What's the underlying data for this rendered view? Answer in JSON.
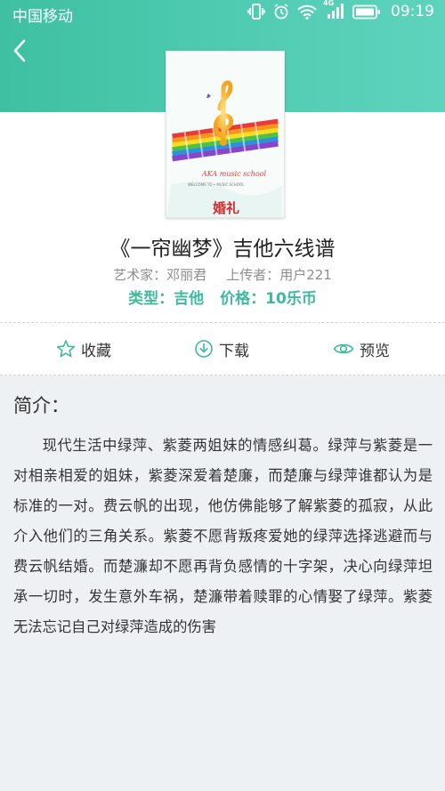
{
  "status_bar": {
    "carrier": "中国移动",
    "network_label": "4G",
    "time": "09:19"
  },
  "header": {
    "back_icon": "chevron-left-icon",
    "background_color": "#4fcab0"
  },
  "cover": {
    "headline": "AKA music school",
    "subline": "WELCOME TO • MUSIC SCHOOL",
    "logo_text": "婚礼"
  },
  "score": {
    "title": "《一帘幽梦》吉他六线谱",
    "artist_label": "艺术家：邓丽君",
    "uploader_label": "上传者：用户221",
    "type_label": "类型：吉他",
    "price_label": "价格：10乐币"
  },
  "actions": [
    {
      "label": "收藏",
      "icon": "star-icon"
    },
    {
      "label": "下载",
      "icon": "download-icon"
    },
    {
      "label": "预览",
      "icon": "eye-icon"
    }
  ],
  "intro": {
    "heading": "简介：",
    "body": "现代生活中绿萍、紫菱两姐妹的情感纠葛。绿萍与紫菱是一对相亲相爱的姐妹，紫菱深爱着楚廉，而楚廉与绿萍谁都认为是标准的一对。费云帆的出现，他仿佛能够了解紫菱的孤寂，从此介入他们的三角关系。紫菱不愿背叛疼爱她的绿萍选择逃避而与费云帆结婚。而楚濂却不愿再背负感情的十字架，决心向绿萍坦承一切时，发生意外车祸，楚濂带着赎罪的心情娶了绿萍。紫菱无法忘记自己对绿萍造成的伤害"
  },
  "colors": {
    "accent": "#3eb99f",
    "page_background": "#eef1f3"
  }
}
